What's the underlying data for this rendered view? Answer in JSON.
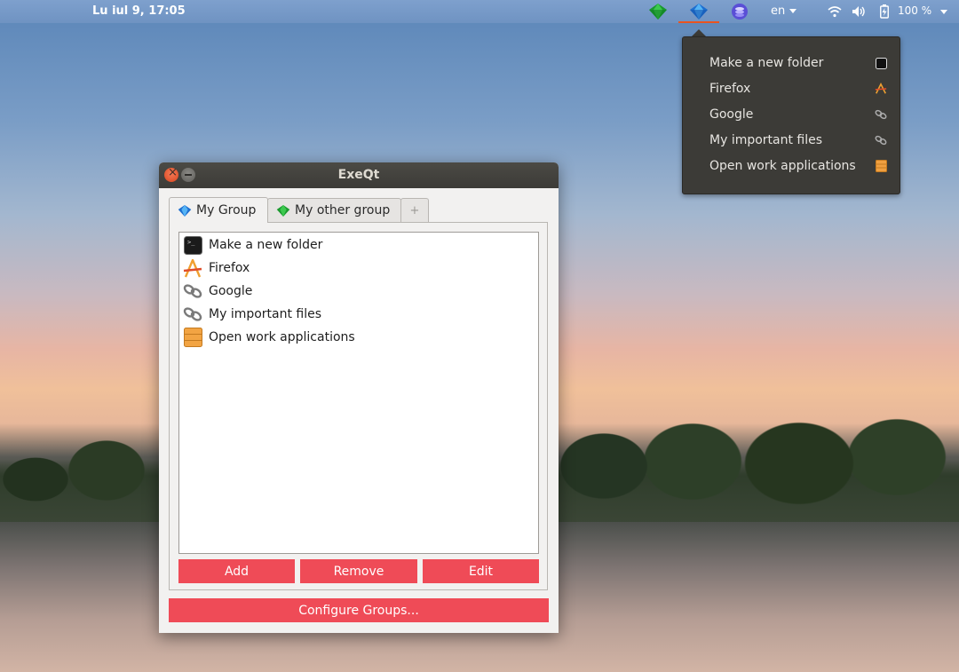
{
  "top_panel": {
    "clock": "Lu iul  9, 17:05",
    "language": "en",
    "battery_percent": "100 %"
  },
  "tray_menu": {
    "items": [
      {
        "label": "Make a new folder",
        "icon": "terminal-icon"
      },
      {
        "label": "Firefox",
        "icon": "firefox-icon"
      },
      {
        "label": "Google",
        "icon": "link-icon"
      },
      {
        "label": "My important files",
        "icon": "link-icon"
      },
      {
        "label": "Open work applications",
        "icon": "archive-icon"
      }
    ]
  },
  "window": {
    "title": "ExeQt",
    "tabs": [
      {
        "label": "My Group",
        "icon": "blue-diamond-icon",
        "active": true
      },
      {
        "label": "My other group",
        "icon": "green-diamond-icon",
        "active": false
      },
      {
        "label": "+",
        "icon": "add-tab-icon",
        "active": false
      }
    ],
    "items": [
      {
        "label": "Make a new folder",
        "icon": "terminal-icon"
      },
      {
        "label": "Firefox",
        "icon": "firefox-icon"
      },
      {
        "label": "Google",
        "icon": "link-icon"
      },
      {
        "label": "My important files",
        "icon": "link-icon"
      },
      {
        "label": "Open work applications",
        "icon": "archive-icon"
      }
    ],
    "buttons": {
      "add": "Add",
      "remove": "Remove",
      "edit": "Edit",
      "configure": "Configure Groups..."
    }
  },
  "colors": {
    "accent_button": "#ef4b57",
    "panel_blue": "#7ea0cd",
    "dark_menu": "#3c3b37",
    "active_indicator": "#e95420"
  }
}
